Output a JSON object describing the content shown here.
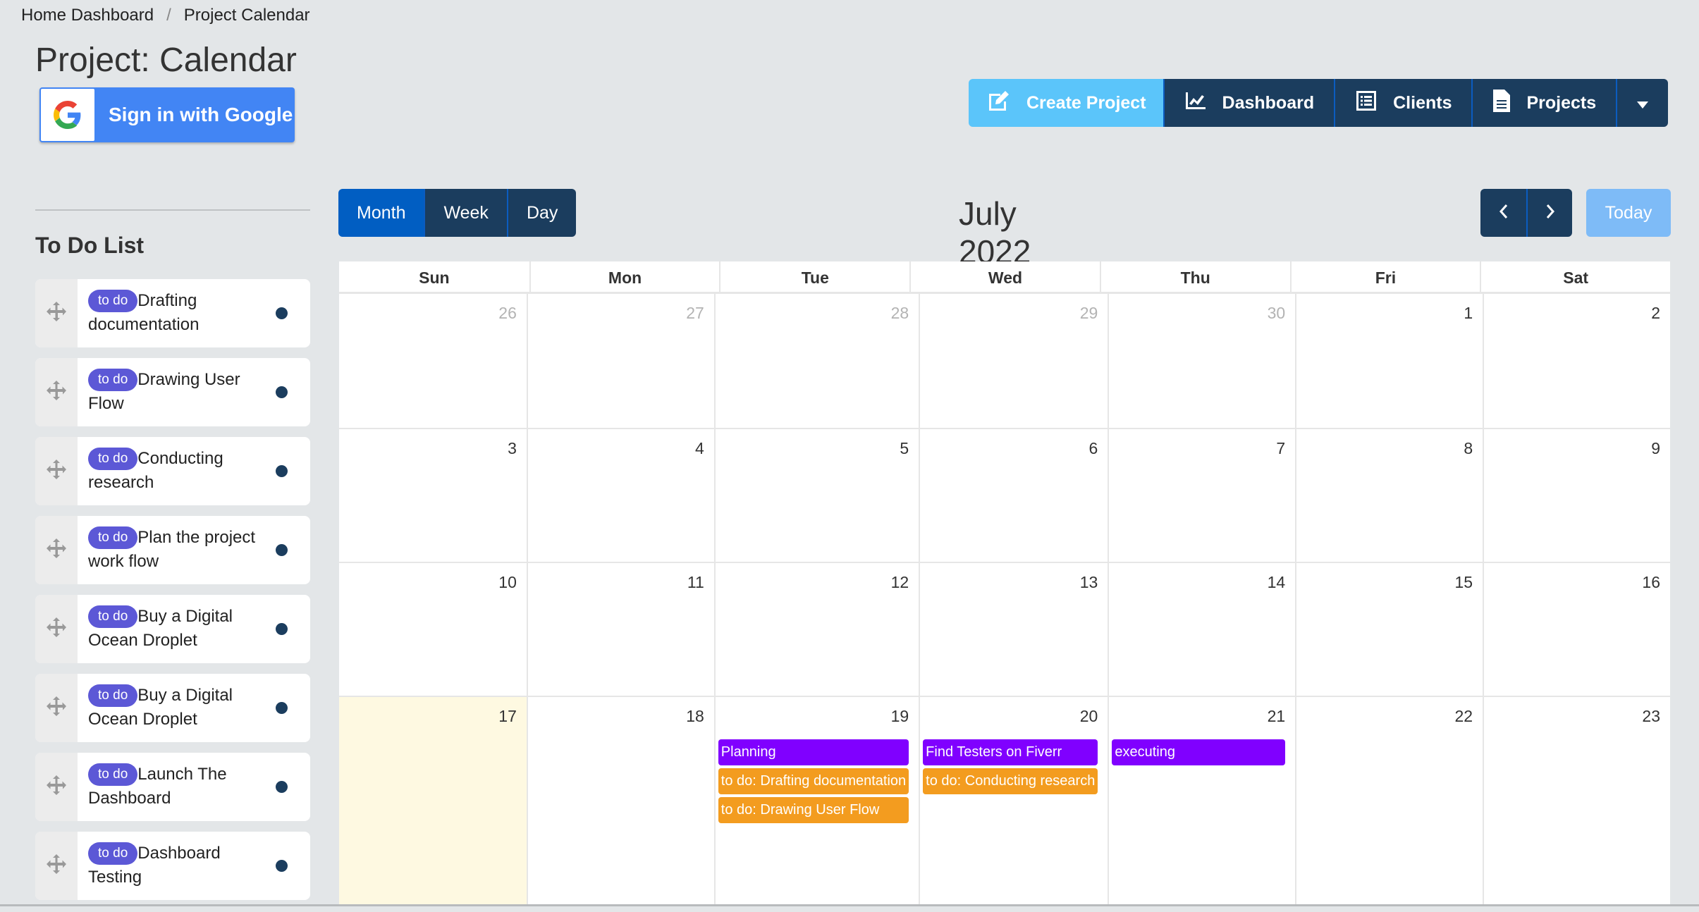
{
  "breadcrumb": {
    "items": [
      "Home Dashboard",
      "Project Calendar"
    ],
    "separator": "/"
  },
  "page_title": "Project: Calendar",
  "google_signin": {
    "label": "Sign in with Google",
    "icon": "google-g-icon"
  },
  "top_nav": {
    "create_project": {
      "label": "Create Project",
      "icon": "edit-icon"
    },
    "dashboard": {
      "label": "Dashboard",
      "icon": "chart-line-icon"
    },
    "clients": {
      "label": "Clients",
      "icon": "list-icon"
    },
    "projects": {
      "label": "Projects",
      "icon": "document-icon"
    },
    "more": {
      "icon": "caret-down-icon"
    }
  },
  "todo": {
    "title": "To Do List",
    "items": [
      {
        "badge": "to do",
        "text": "Drafting documentation"
      },
      {
        "badge": "to do",
        "text": "Drawing User Flow"
      },
      {
        "badge": "to do",
        "text": "Conducting research"
      },
      {
        "badge": "to do",
        "text": "Plan the project work flow"
      },
      {
        "badge": "to do",
        "text": "Buy a Digital Ocean Droplet"
      },
      {
        "badge": "to do",
        "text": "Buy a Digital Ocean Droplet"
      },
      {
        "badge": "to do",
        "text": "Launch The Dashboard"
      },
      {
        "badge": "to do",
        "text": "Dashboard Testing"
      }
    ]
  },
  "calendar": {
    "views": {
      "month": "Month",
      "week": "Week",
      "day": "Day",
      "active": "month"
    },
    "title": "July 2022",
    "today_label": "Today",
    "weekdays": [
      "Sun",
      "Mon",
      "Tue",
      "Wed",
      "Thu",
      "Fri",
      "Sat"
    ],
    "weeks": [
      [
        {
          "d": "26",
          "other": true
        },
        {
          "d": "27",
          "other": true
        },
        {
          "d": "28",
          "other": true
        },
        {
          "d": "29",
          "other": true
        },
        {
          "d": "30",
          "other": true
        },
        {
          "d": "1"
        },
        {
          "d": "2"
        }
      ],
      [
        {
          "d": "3"
        },
        {
          "d": "4"
        },
        {
          "d": "5"
        },
        {
          "d": "6"
        },
        {
          "d": "7"
        },
        {
          "d": "8"
        },
        {
          "d": "9"
        }
      ],
      [
        {
          "d": "10"
        },
        {
          "d": "11"
        },
        {
          "d": "12"
        },
        {
          "d": "13"
        },
        {
          "d": "14"
        },
        {
          "d": "15"
        },
        {
          "d": "16"
        }
      ],
      [
        {
          "d": "17",
          "today": true
        },
        {
          "d": "18"
        },
        {
          "d": "19",
          "events": [
            {
              "title": "Planning",
              "type": "project"
            },
            {
              "title": "to do: Drafting documentation",
              "type": "todo"
            },
            {
              "title": "to do: Drawing User Flow",
              "type": "todo"
            }
          ]
        },
        {
          "d": "20",
          "events": [
            {
              "title": "Find Testers on Fiverr",
              "type": "project"
            },
            {
              "title": "to do: Conducting research",
              "type": "todo"
            }
          ]
        },
        {
          "d": "21",
          "events": [
            {
              "title": "executing",
              "type": "project"
            }
          ]
        },
        {
          "d": "22"
        },
        {
          "d": "23"
        }
      ]
    ],
    "event_colors": {
      "project": "#8000ff",
      "todo": "#f39c1f"
    }
  }
}
